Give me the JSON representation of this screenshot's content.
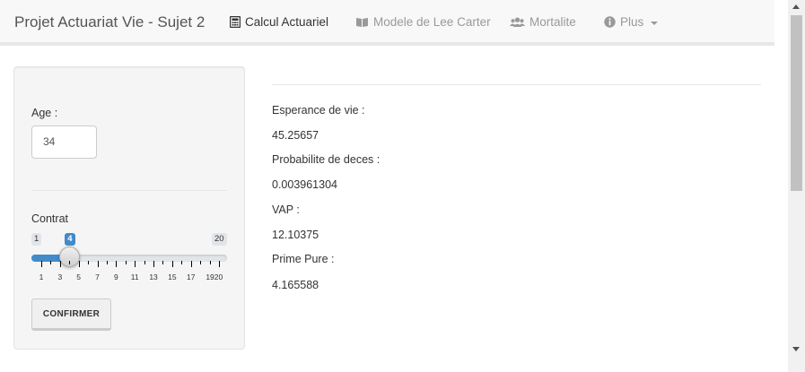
{
  "navbar": {
    "brand": "Projet Actuariat Vie - Sujet 2",
    "tabs": [
      {
        "label": "Calcul Actuariel",
        "icon": "calculator-icon",
        "active": true
      },
      {
        "label": "Modele de Lee Carter",
        "icon": "book-icon",
        "active": false
      },
      {
        "label": "Mortalite",
        "icon": "users-icon",
        "active": false
      },
      {
        "label": "Plus",
        "icon": "info-circle-icon",
        "active": false
      }
    ]
  },
  "sidebar": {
    "age_label": "Age :",
    "age_value": "34",
    "contrat_label": "Contrat",
    "slider": {
      "min": 1,
      "max": 20,
      "value": 4,
      "min_label": "1",
      "max_label": "20",
      "value_label": "4",
      "ticks": [
        "1",
        "3",
        "5",
        "7",
        "9",
        "11",
        "13",
        "15",
        "17",
        "1920"
      ]
    },
    "confirm_label": "CONFIRMER"
  },
  "results": [
    {
      "label": "Esperance de vie :",
      "value": "45.25657"
    },
    {
      "label": "Probabilite de deces :",
      "value": "0.003961304"
    },
    {
      "label": "VAP :",
      "value": "12.10375"
    },
    {
      "label": "Prime Pure :",
      "value": "4.165588"
    }
  ],
  "colors": {
    "accent": "#428bca",
    "navbar_bg": "#f8f8f8",
    "panel_bg": "#f5f5f5"
  }
}
